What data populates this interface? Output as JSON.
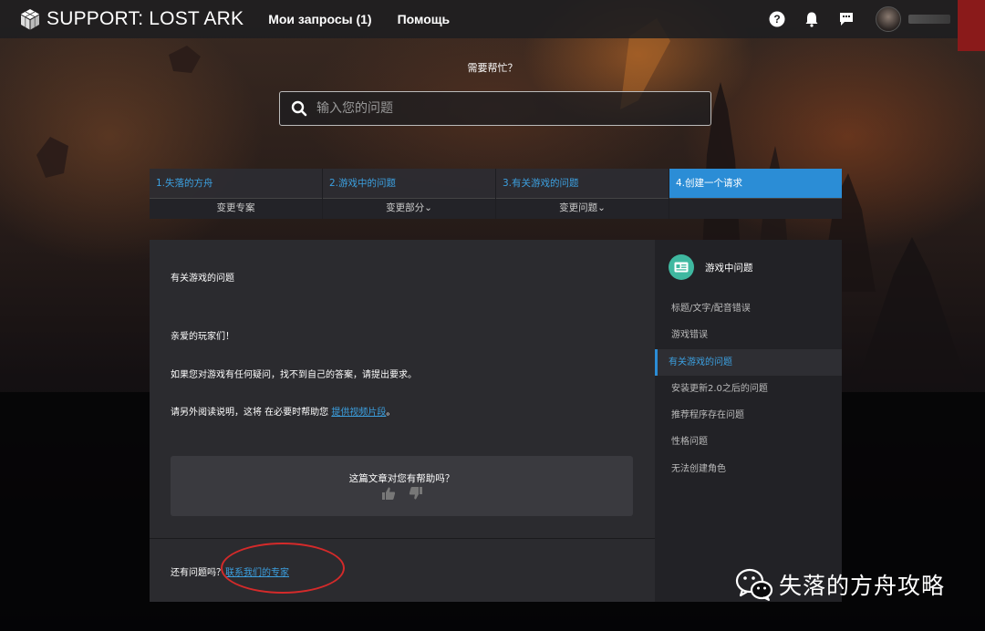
{
  "topbar": {
    "logo_text": "SUPPORT: LOST ARK",
    "nav": [
      {
        "label": "Мои запросы (1)"
      },
      {
        "label": "Помощь"
      }
    ],
    "icons": [
      "help-circle-icon",
      "bell-icon",
      "chat-icon"
    ]
  },
  "help": {
    "title": "需要帮忙？",
    "search_placeholder": "输入您的问题"
  },
  "steps": [
    {
      "title": "1.失落的方舟",
      "sub": "变更专案"
    },
    {
      "title": "2.游戏中的问题",
      "sub": "变更部分⌄"
    },
    {
      "title": "3.有关游戏的问题",
      "sub": "变更问题⌄"
    },
    {
      "title": "4.创建一个请求",
      "sub": ""
    }
  ],
  "article": {
    "title": "有关游戏的问题",
    "greeting": "亲爱的玩家们！",
    "line1": "如果您对游戏有任何疑问，找不到自己的答案，请提出要求。",
    "line2_prefix": "请另外阅读说明，这将 在必要时帮助您 ",
    "line2_link": "提供视频片段",
    "line2_suffix": "。",
    "feedback_question": "这篇文章对您有帮助吗？",
    "contact_prefix": "还有问题吗？",
    "contact_link": "联系我们的专家"
  },
  "sidebar": {
    "heading": "游戏中问题",
    "items": [
      {
        "label": "标题/文字/配音错误"
      },
      {
        "label": "游戏错误"
      },
      {
        "label": "有关游戏的问题"
      },
      {
        "label": "安装更新2.0之后的问题"
      },
      {
        "label": "推荐程序存在问题"
      },
      {
        "label": "性格问题"
      },
      {
        "label": "无法创建角色"
      }
    ],
    "active_index": 2
  },
  "watermark": {
    "text": "失落的方舟攻略"
  },
  "colors": {
    "accent": "#2b8dd6",
    "link": "#3ca0e0",
    "annotation": "#d42a2a",
    "sidebar_icon": "#3fb8a0"
  }
}
